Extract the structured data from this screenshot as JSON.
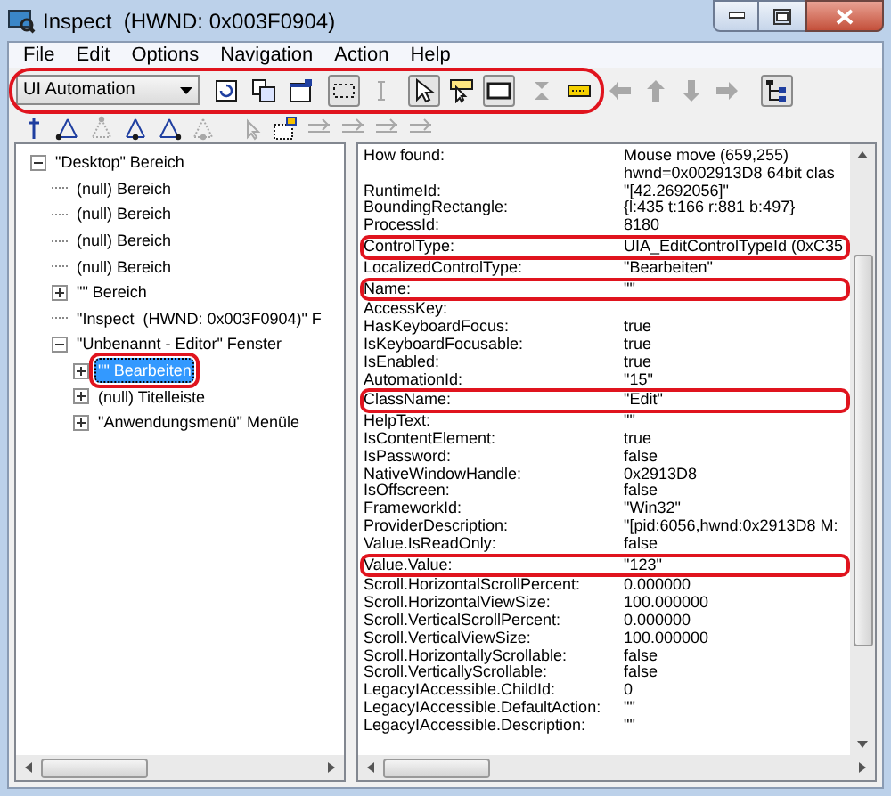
{
  "window": {
    "title": "Inspect  (HWND: 0x003F0904)"
  },
  "menu": [
    "File",
    "Edit",
    "Options",
    "Navigation",
    "Action",
    "Help"
  ],
  "toolbar": {
    "annotated": true,
    "mode": "UI Automation",
    "buttons": [
      {
        "kind": "refresh",
        "on": false,
        "disabled": false
      },
      {
        "kind": "copy",
        "on": false,
        "disabled": false
      },
      {
        "kind": "properties",
        "on": false,
        "disabled": false
      },
      {
        "kind": "focus",
        "on": true,
        "disabled": false
      },
      {
        "kind": "caret",
        "on": false,
        "disabled": true
      },
      {
        "kind": "pointer",
        "on": true,
        "disabled": false
      },
      {
        "kind": "tooltip",
        "on": false,
        "disabled": false
      },
      {
        "kind": "rectangle",
        "on": true,
        "disabled": false
      },
      {
        "kind": "collapse",
        "on": false,
        "disabled": true
      },
      {
        "kind": "highlight",
        "on": false,
        "disabled": false
      },
      {
        "kind": "left",
        "on": false,
        "disabled": true
      },
      {
        "kind": "up",
        "on": false,
        "disabled": true
      },
      {
        "kind": "down",
        "on": false,
        "disabled": true
      },
      {
        "kind": "right",
        "on": false,
        "disabled": true
      },
      {
        "kind": "tree",
        "on": true,
        "disabled": false
      }
    ]
  },
  "nav_toolbar": [
    {
      "kind": "parent",
      "disabled": false
    },
    {
      "kind": "first",
      "disabled": false
    },
    {
      "kind": "prev",
      "disabled": true
    },
    {
      "kind": "next",
      "disabled": false
    },
    {
      "kind": "last",
      "disabled": false
    },
    {
      "kind": "child",
      "disabled": true
    },
    {
      "kind": "click",
      "disabled": true
    },
    {
      "kind": "expand",
      "disabled": false
    },
    {
      "kind": "act1",
      "disabled": true
    },
    {
      "kind": "act2",
      "disabled": true
    },
    {
      "kind": "act3",
      "disabled": true
    },
    {
      "kind": "act4",
      "disabled": true
    }
  ],
  "tree": [
    {
      "label": "\"Desktop\" Bereich",
      "kind": "node",
      "expanded": true,
      "selected": false,
      "annotated": false,
      "children": [
        {
          "label": "(null) Bereich",
          "kind": "leaf",
          "selected": false,
          "annotated": false
        },
        {
          "label": "(null) Bereich",
          "kind": "leaf",
          "selected": false,
          "annotated": false
        },
        {
          "label": "(null) Bereich",
          "kind": "leaf",
          "selected": false,
          "annotated": false
        },
        {
          "label": "(null) Bereich",
          "kind": "leaf",
          "selected": false,
          "annotated": false
        },
        {
          "label": "\"\" Bereich",
          "kind": "node",
          "expanded": false,
          "selected": false,
          "annotated": false
        },
        {
          "label": "\"Inspect  (HWND: 0x003F0904)\" F",
          "kind": "leaf",
          "selected": false,
          "annotated": false
        },
        {
          "label": "\"Unbenannt - Editor\" Fenster",
          "kind": "node",
          "expanded": true,
          "selected": false,
          "annotated": false,
          "children": [
            {
              "label": "\"\" Bearbeiten",
              "kind": "node",
              "expanded": false,
              "selected": true,
              "annotated": true
            },
            {
              "label": "(null) Titelleiste",
              "kind": "node",
              "expanded": false,
              "selected": false,
              "annotated": false
            },
            {
              "label": "\"Anwendungsmenü\" Menüle",
              "kind": "node",
              "expanded": false,
              "selected": false,
              "annotated": false
            }
          ]
        }
      ]
    }
  ],
  "properties": [
    {
      "name": "How found:",
      "value": [
        "Mouse move (659,255)",
        "hwnd=0x002913D8 64bit clas"
      ],
      "annotated": false
    },
    {
      "name": "RuntimeId:",
      "value": [
        "\"[42.2692056]\""
      ],
      "annotated": false
    },
    {
      "name": "BoundingRectangle:",
      "value": [
        "{l:435 t:166 r:881 b:497}"
      ],
      "annotated": false
    },
    {
      "name": "ProcessId:",
      "value": [
        "8180"
      ],
      "annotated": false
    },
    {
      "name": "ControlType:",
      "value": [
        "UIA_EditControlTypeId (0xC35"
      ],
      "annotated": true
    },
    {
      "name": "LocalizedControlType:",
      "value": [
        "\"Bearbeiten\""
      ],
      "annotated": false
    },
    {
      "name": "Name:",
      "value": [
        "\"\""
      ],
      "annotated": true
    },
    {
      "name": "AccessKey:",
      "annotated": false
    },
    {
      "name": "HasKeyboardFocus:",
      "value": [
        "true"
      ],
      "annotated": false
    },
    {
      "name": "IsKeyboardFocusable:",
      "value": [
        "true"
      ],
      "annotated": false
    },
    {
      "name": "IsEnabled:",
      "value": [
        "true"
      ],
      "annotated": false
    },
    {
      "name": "AutomationId:",
      "value": [
        "\"15\""
      ],
      "annotated": false
    },
    {
      "name": "ClassName:",
      "value": [
        "\"Edit\""
      ],
      "annotated": true
    },
    {
      "name": "HelpText:",
      "value": [
        "\"\""
      ],
      "annotated": false
    },
    {
      "name": "IsContentElement:",
      "value": [
        "true"
      ],
      "annotated": false
    },
    {
      "name": "IsPassword:",
      "value": [
        "false"
      ],
      "annotated": false
    },
    {
      "name": "NativeWindowHandle:",
      "value": [
        "0x2913D8"
      ],
      "annotated": false
    },
    {
      "name": "IsOffscreen:",
      "value": [
        "false"
      ],
      "annotated": false
    },
    {
      "name": "FrameworkId:",
      "value": [
        "\"Win32\""
      ],
      "annotated": false
    },
    {
      "name": "ProviderDescription:",
      "value": [
        "\"[pid:6056,hwnd:0x2913D8 M:"
      ],
      "annotated": false
    },
    {
      "name": "Value.IsReadOnly:",
      "value": [
        "false"
      ],
      "annotated": false
    },
    {
      "name": "Value.Value:",
      "value": [
        "\"123\""
      ],
      "annotated": true
    },
    {
      "name": "Scroll.HorizontalScrollPercent:",
      "value": [
        "0.000000"
      ],
      "annotated": false
    },
    {
      "name": "Scroll.HorizontalViewSize:",
      "value": [
        "100.000000"
      ],
      "annotated": false
    },
    {
      "name": "Scroll.VerticalScrollPercent:",
      "value": [
        "0.000000"
      ],
      "annotated": false
    },
    {
      "name": "Scroll.VerticalViewSize:",
      "value": [
        "100.000000"
      ],
      "annotated": false
    },
    {
      "name": "Scroll.HorizontallyScrollable:",
      "value": [
        "false"
      ],
      "annotated": false
    },
    {
      "name": "Scroll.VerticallyScrollable:",
      "value": [
        "false"
      ],
      "annotated": false
    },
    {
      "name": "LegacyIAccessible.ChildId:",
      "value": [
        "0"
      ],
      "annotated": false
    },
    {
      "name": "LegacyIAccessible.DefaultAction:",
      "value": [
        "\"\""
      ],
      "annotated": false
    },
    {
      "name": "LegacyIAccessible.Description:",
      "value": [
        "\"\""
      ],
      "annotated": false
    }
  ]
}
